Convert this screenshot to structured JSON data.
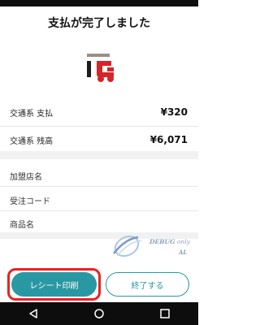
{
  "screen": {
    "title": "支払が完了しました"
  },
  "payment": {
    "items": [
      {
        "label": "交通系 支払",
        "amount": "¥320"
      },
      {
        "label": "交通系 残高",
        "amount": "¥6,071"
      }
    ]
  },
  "details": {
    "merchant_label": "加盟店名",
    "order_code_label": "受注コード",
    "product_label": "商品名"
  },
  "watermark": {
    "text": "DEBUG",
    "only": " only",
    "sub": "AL"
  },
  "buttons": {
    "receipt": "レシート印刷",
    "end": "終了する"
  },
  "colors": {
    "accent": "#2a98a3",
    "highlight": "#e8231f",
    "logo_red": "#d4252a"
  },
  "icons": {
    "logo": "ic-logo",
    "back": "back-icon",
    "home": "home-icon",
    "recents": "recents-icon"
  }
}
